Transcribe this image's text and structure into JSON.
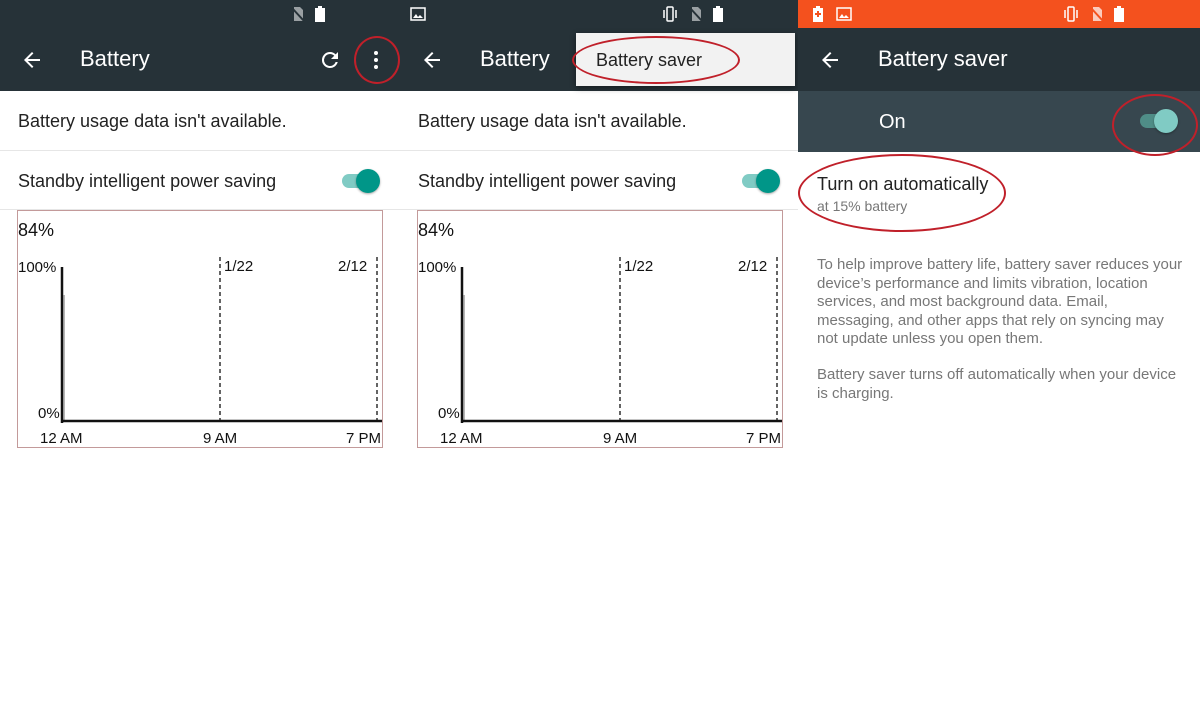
{
  "colors": {
    "toolbar": "#263238",
    "status_orange": "#f4511e",
    "accent": "#009688",
    "annotation": "#c0202a"
  },
  "panel1": {
    "status_icons": [
      "no-sim-icon",
      "battery-icon"
    ],
    "toolbar": {
      "title": "Battery",
      "icons": [
        "back-arrow-icon",
        "refresh-icon",
        "more-vert-icon"
      ]
    },
    "usage_message": "Battery usage data isn't available.",
    "standby": {
      "label": "Standby intelligent power saving",
      "enabled": true
    },
    "chart": {
      "current_level": "84%",
      "y_top": "100%",
      "y_bottom": "0%",
      "markers": [
        "1/22",
        "2/12"
      ],
      "x_labels": [
        "12 AM",
        "9 AM",
        "7 PM"
      ]
    }
  },
  "panel2": {
    "status_icons": [
      "image-icon",
      "vibrate-icon",
      "no-sim-icon",
      "battery-icon"
    ],
    "toolbar": {
      "title": "Battery",
      "icons": [
        "back-arrow-icon"
      ]
    },
    "menu": {
      "item": "Battery saver"
    },
    "usage_message": "Battery usage data isn't available.",
    "standby": {
      "label": "Standby intelligent power saving",
      "enabled": true
    },
    "chart": {
      "current_level": "84%",
      "y_top": "100%",
      "y_bottom": "0%",
      "markers": [
        "1/22",
        "2/12"
      ],
      "x_labels": [
        "12 AM",
        "9 AM",
        "7 PM"
      ]
    }
  },
  "panel3": {
    "status_icons": [
      "battery-saver-icon",
      "image-icon",
      "vibrate-icon",
      "no-sim-icon",
      "battery-icon"
    ],
    "toolbar": {
      "title": "Battery saver",
      "icons": [
        "back-arrow-icon"
      ]
    },
    "master": {
      "label": "On",
      "enabled": true
    },
    "auto": {
      "title": "Turn on automatically",
      "subtitle": "at 15% battery"
    },
    "description": [
      "To help improve battery life, battery saver reduces your device’s performance and limits vibration, location services, and most background data. Email, messaging, and other apps that rely on syncing may not update unless you open them.",
      "Battery saver turns off automatically when your device is charging."
    ]
  }
}
